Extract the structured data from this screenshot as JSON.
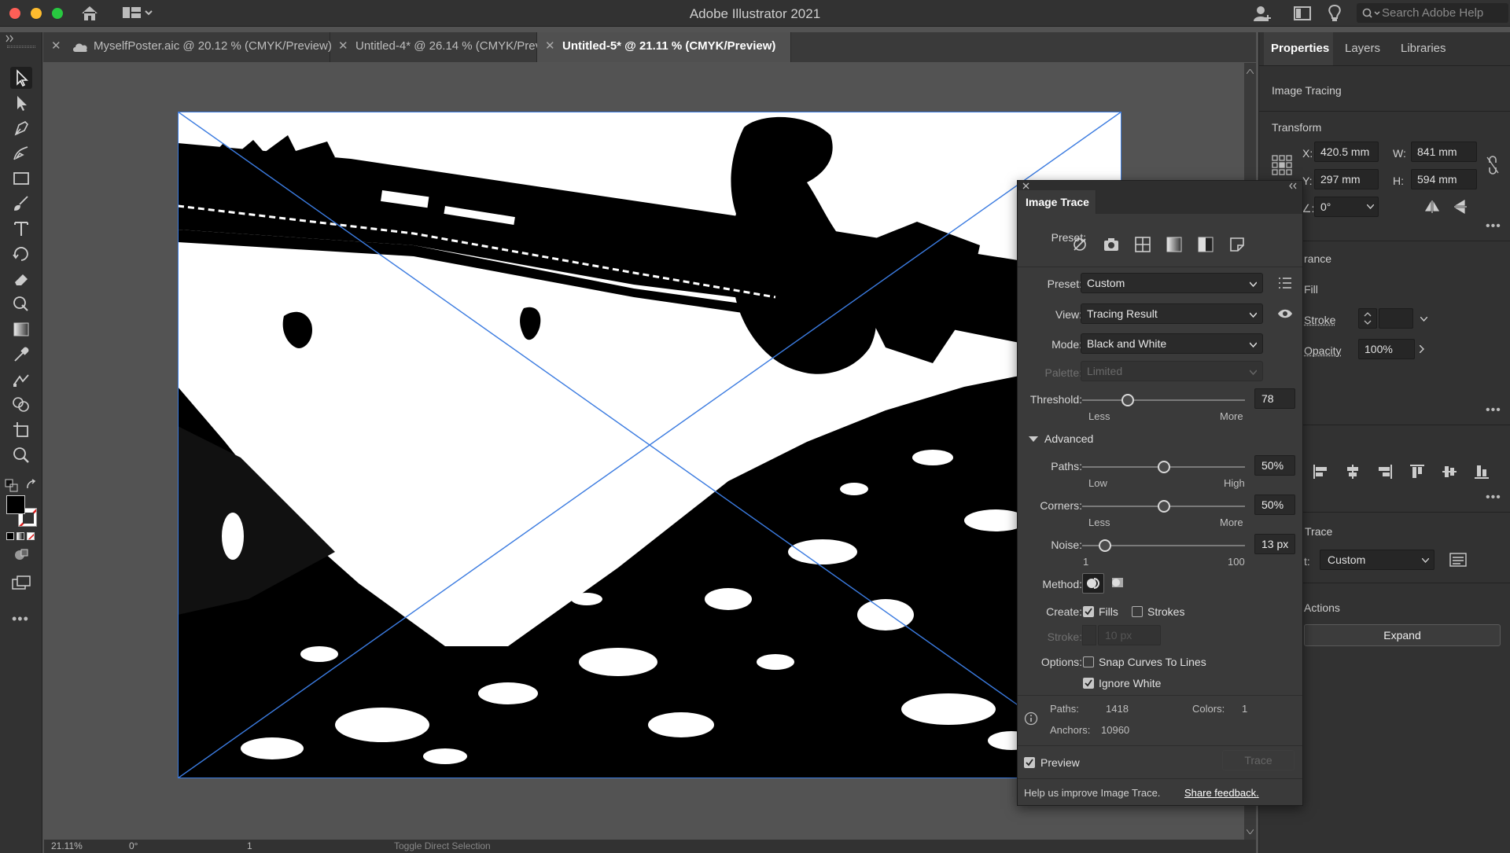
{
  "window": {
    "title": "Adobe Illustrator 2021"
  },
  "search": {
    "placeholder": "Search Adobe Help"
  },
  "tabs": [
    {
      "label": "MyselfPoster.aic @ 20.12 % (CMYK/Preview)",
      "active": false
    },
    {
      "label": "Untitled-4* @ 26.14 % (CMYK/Preview)",
      "active": false
    },
    {
      "label": "Untitled-5* @ 21.11 % (CMYK/Preview)",
      "active": true
    }
  ],
  "tools": [
    "selection-tool",
    "direct-selection-tool",
    "pen-tool",
    "curvature-tool",
    "rectangle-tool",
    "paintbrush-tool",
    "type-tool",
    "rotate-tool",
    "eraser-tool",
    "puppet-warp-tool",
    "gradient-tool",
    "eyedropper-tool",
    "blend-tool",
    "shape-builder-tool",
    "artboard-tool",
    "zoom-tool"
  ],
  "status": {
    "zoom": "21.11%",
    "rotation": "0°",
    "artboard": "1",
    "message": "Toggle Direct Selection"
  },
  "properties": {
    "tabs": [
      "Properties",
      "Layers",
      "Libraries"
    ],
    "selection_type": "Image Tracing",
    "transform": {
      "title": "Transform",
      "x_label": "X:",
      "x": "420.5 mm",
      "y_label": "Y:",
      "y": "297 mm",
      "w_label": "W:",
      "w": "841 mm",
      "h_label": "H:",
      "h": "594 mm",
      "angle_label": "∠:",
      "angle": "0°"
    },
    "appearance": {
      "title_partial": "rance",
      "fill": "Fill",
      "stroke": "Stroke",
      "opacity_label": "Opacity",
      "opacity": "100%"
    },
    "image_trace": {
      "title_partial": "Trace",
      "preset_label": "t:",
      "preset": "Custom"
    },
    "quick_actions": {
      "title_partial": "Actions",
      "expand": "Expand"
    }
  },
  "image_trace": {
    "title": "Image Trace",
    "preset_label": "Preset:",
    "preset": "Custom",
    "view_label": "View:",
    "view": "Tracing Result",
    "mode_label": "Mode:",
    "mode": "Black and White",
    "palette_label": "Palette:",
    "palette": "Limited",
    "threshold_label": "Threshold:",
    "threshold": "78",
    "threshold_min": "Less",
    "threshold_max": "More",
    "threshold_frac": 0.28,
    "advanced_label": "Advanced",
    "paths_label": "Paths:",
    "paths": "50%",
    "paths_min": "Low",
    "paths_max": "High",
    "paths_frac": 0.5,
    "corners_label": "Corners:",
    "corners": "50%",
    "corners_min": "Less",
    "corners_max": "More",
    "corners_frac": 0.5,
    "noise_label": "Noise:",
    "noise": "13 px",
    "noise_min": "1",
    "noise_max": "100",
    "noise_frac": 0.14,
    "method_label": "Method:",
    "create_label": "Create:",
    "fills": "Fills",
    "fills_checked": true,
    "strokes": "Strokes",
    "strokes_checked": false,
    "stroke_label": "Stroke:",
    "stroke": "10 px",
    "options_label": "Options:",
    "snap": "Snap Curves To Lines",
    "snap_checked": false,
    "ignore_white": "Ignore White",
    "ignore_white_checked": true,
    "paths_stat_label": "Paths:",
    "paths_stat": "1418",
    "colors_stat_label": "Colors:",
    "colors_stat": "1",
    "anchors_stat_label": "Anchors:",
    "anchors_stat": "10960",
    "preview_label": "Preview",
    "preview_checked": true,
    "trace_button": "Trace",
    "feedback_text": "Help us improve Image Trace.",
    "feedback_link": "Share feedback."
  }
}
